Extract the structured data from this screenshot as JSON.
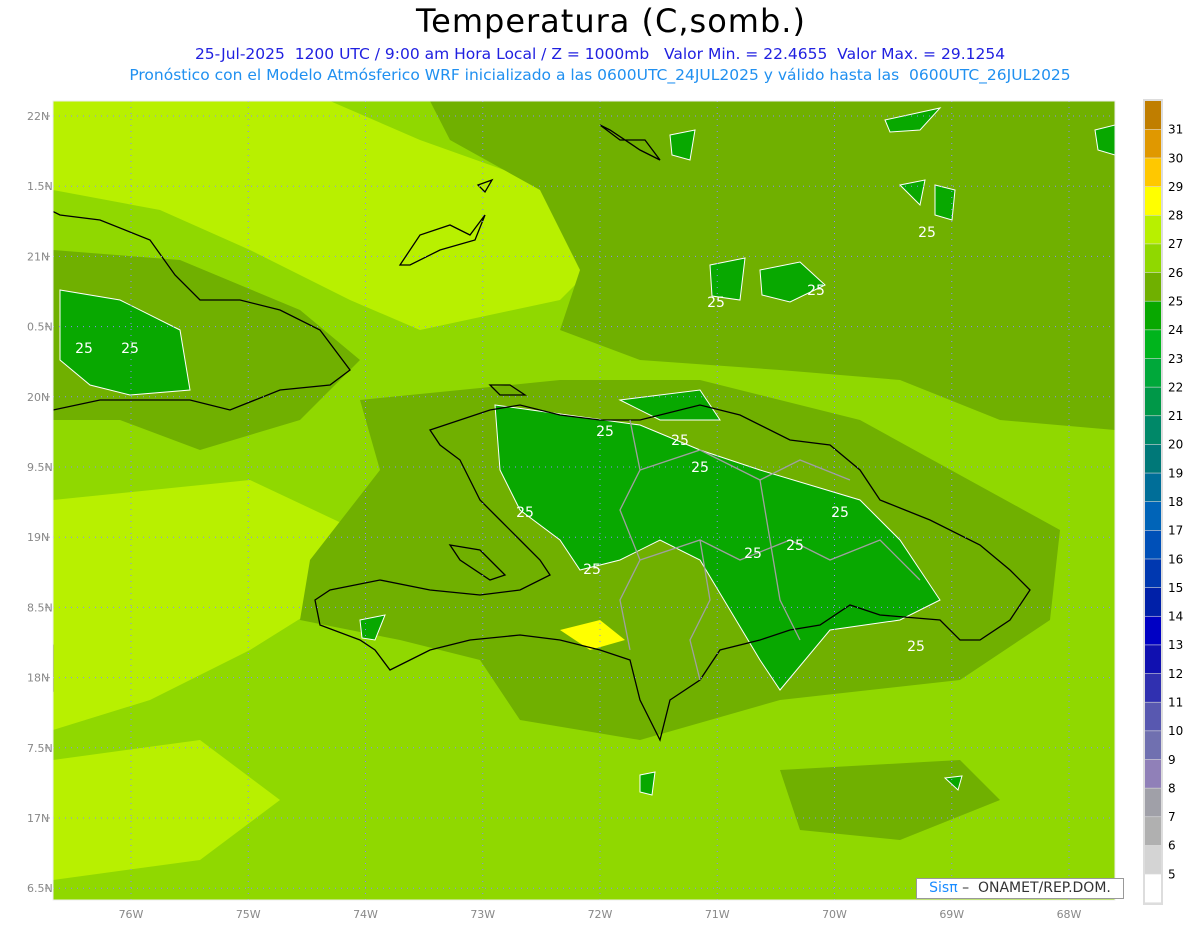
{
  "title": "Temperatura (C,somb.)",
  "subtitle1": "25-Jul-2025  1200 UTC / 9:00 am Hora Local / Z = 1000mb   Valor Min. = 22.4655  Valor Max. = 29.1254",
  "subtitle2": "Pronóstico con el Modelo Atmósferico WRF inicializado a las 0600UTC_24JUL2025 y válido hasta las  0600UTC_26JUL2025",
  "lat_ticks": [
    "22N",
    "1.5N",
    "21N",
    "0.5N",
    "20N",
    "9.5N",
    "19N",
    "8.5N",
    "18N",
    "7.5N",
    "17N",
    "6.5N"
  ],
  "lon_ticks": [
    "76W",
    "75W",
    "74W",
    "73W",
    "72W",
    "71W",
    "70W",
    "69W",
    "68W"
  ],
  "colorbar": {
    "labels": [
      "31",
      "30",
      "29",
      "28",
      "27",
      "26",
      "25",
      "24",
      "23",
      "22",
      "21",
      "20",
      "19",
      "18",
      "17",
      "16",
      "15",
      "14",
      "13",
      "12",
      "11",
      "10",
      "9",
      "8",
      "7",
      "6",
      "5"
    ],
    "colors": [
      "#c07e00",
      "#e09800",
      "#ffc800",
      "#ffff00",
      "#b8f000",
      "#90d800",
      "#70b000",
      "#08a800",
      "#00b41c",
      "#00a83a",
      "#009848",
      "#008868",
      "#007878",
      "#006e98",
      "#0064b8",
      "#0050b8",
      "#0038b0",
      "#0020a8",
      "#0000c4",
      "#1010b0",
      "#3030b0",
      "#5858b0",
      "#7070b0",
      "#9080b8",
      "#a0a0a8",
      "#b0b0b0",
      "#d4d4d4",
      "#ffffff"
    ]
  },
  "contour_labels": [
    "25",
    "25",
    "25",
    "25",
    "25",
    "25",
    "25",
    "25",
    "25",
    "25",
    "25",
    "25",
    "25",
    "25"
  ],
  "logo": {
    "brand": "Sisπ",
    "text": " –  ONAMET/REP.DOM."
  }
}
